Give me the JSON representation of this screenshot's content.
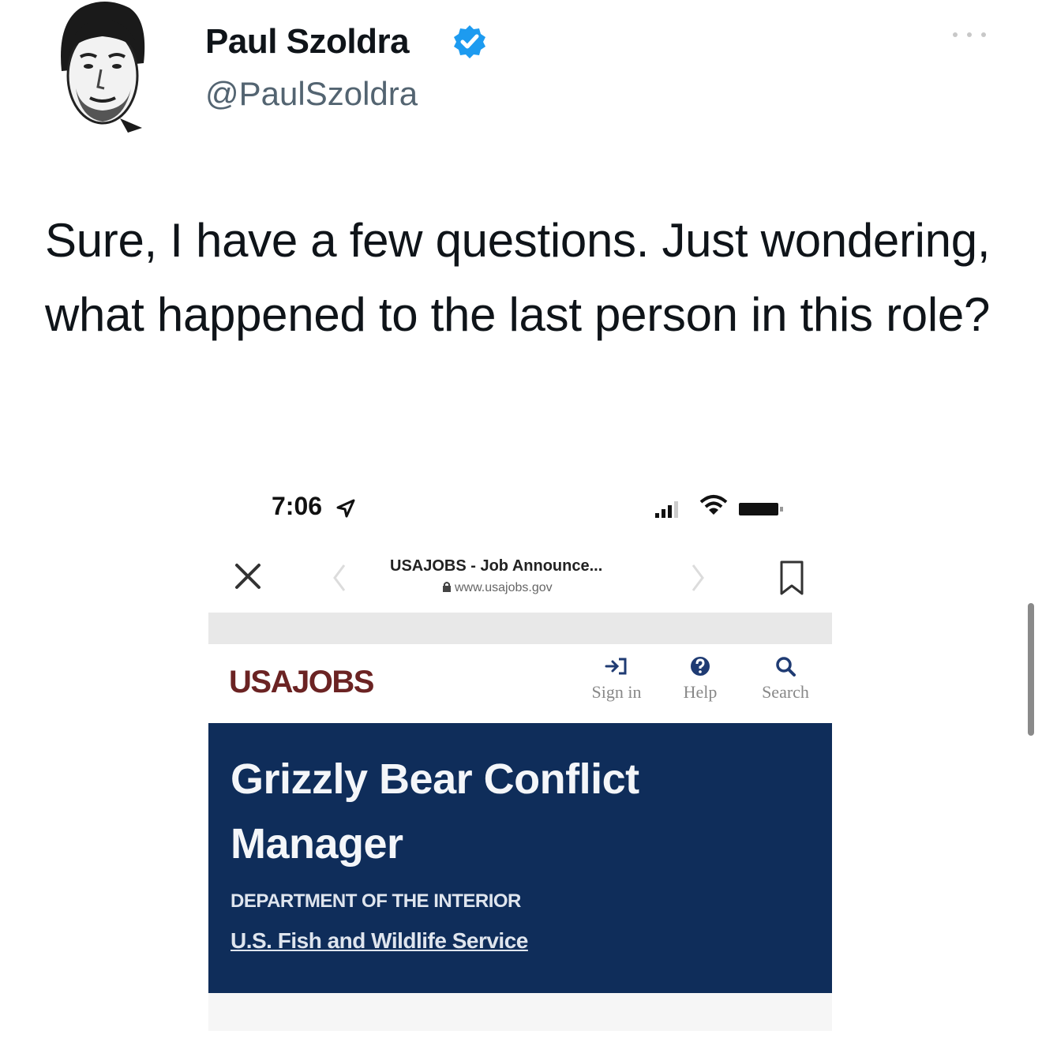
{
  "tweet": {
    "author_name": "Paul Szoldra",
    "author_handle": "@PaulSzoldra",
    "verified": true,
    "text": "Sure, I have a few questions. Just wondering, what happened to the last person in this role?"
  },
  "embedded_screenshot": {
    "status_bar": {
      "time": "7:06"
    },
    "browser": {
      "page_title": "USAJOBS - Job Announce...",
      "url": "www.usajobs.gov"
    },
    "site": {
      "logo": "USAJOBS",
      "nav": [
        {
          "label": "Sign in",
          "icon": "sign-in-icon"
        },
        {
          "label": "Help",
          "icon": "help-icon"
        },
        {
          "label": "Search",
          "icon": "search-icon"
        }
      ]
    },
    "job": {
      "title": "Grizzly Bear Conflict Manager",
      "department": "DEPARTMENT OF THE INTERIOR",
      "agency": "U.S. Fish and Wildlife Service"
    }
  },
  "colors": {
    "banner": "#0f2d5a",
    "logo": "#6b2323",
    "verified": "#1d9bf0",
    "handle": "#536471"
  }
}
